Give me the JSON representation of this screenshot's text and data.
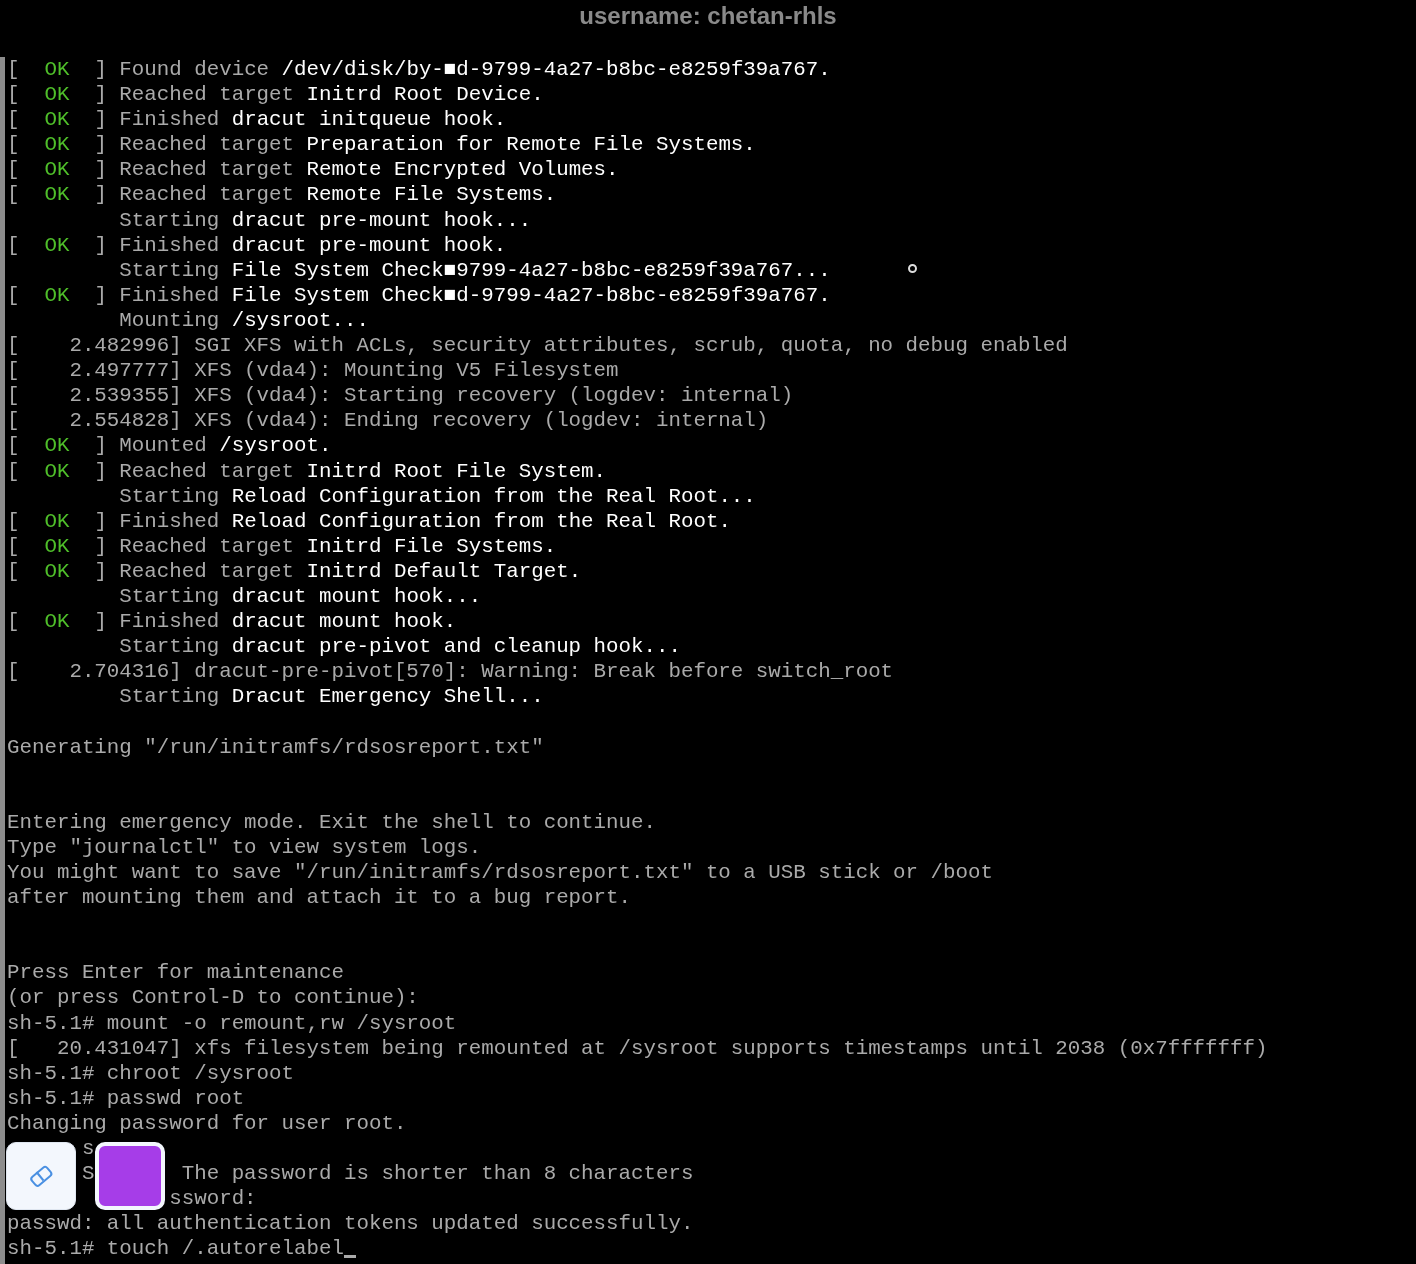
{
  "window": {
    "title": "username: chetan-rhls"
  },
  "lines": [
    {
      "kind": "text",
      "parts": [
        {
          "kind": "dim",
          "text": "[  "
        },
        {
          "kind": "ok",
          "text": "OK"
        },
        {
          "kind": "dim",
          "text": "  ] Found device "
        },
        {
          "kind": "bright",
          "text": "/dev/disk/by-■d-9799-4a27-b8bc-e8259f39a767."
        }
      ]
    },
    {
      "kind": "text",
      "parts": [
        {
          "kind": "dim",
          "text": "[  "
        },
        {
          "kind": "ok",
          "text": "OK"
        },
        {
          "kind": "dim",
          "text": "  ] Reached target "
        },
        {
          "kind": "bright",
          "text": "Initrd Root Device."
        }
      ]
    },
    {
      "kind": "text",
      "parts": [
        {
          "kind": "dim",
          "text": "[  "
        },
        {
          "kind": "ok",
          "text": "OK"
        },
        {
          "kind": "dim",
          "text": "  ] Finished "
        },
        {
          "kind": "bright",
          "text": "dracut initqueue hook."
        }
      ]
    },
    {
      "kind": "text",
      "parts": [
        {
          "kind": "dim",
          "text": "[  "
        },
        {
          "kind": "ok",
          "text": "OK"
        },
        {
          "kind": "dim",
          "text": "  ] Reached target "
        },
        {
          "kind": "bright",
          "text": "Preparation for Remote File Systems."
        }
      ]
    },
    {
      "kind": "text",
      "parts": [
        {
          "kind": "dim",
          "text": "[  "
        },
        {
          "kind": "ok",
          "text": "OK"
        },
        {
          "kind": "dim",
          "text": "  ] Reached target "
        },
        {
          "kind": "bright",
          "text": "Remote Encrypted Volumes."
        }
      ]
    },
    {
      "kind": "text",
      "parts": [
        {
          "kind": "dim",
          "text": "[  "
        },
        {
          "kind": "ok",
          "text": "OK"
        },
        {
          "kind": "dim",
          "text": "  ] Reached target "
        },
        {
          "kind": "bright",
          "text": "Remote File Systems."
        }
      ]
    },
    {
      "kind": "text",
      "parts": [
        {
          "kind": "dim",
          "text": "         Starting "
        },
        {
          "kind": "bright",
          "text": "dracut pre-mount hook..."
        }
      ]
    },
    {
      "kind": "text",
      "parts": [
        {
          "kind": "dim",
          "text": "[  "
        },
        {
          "kind": "ok",
          "text": "OK"
        },
        {
          "kind": "dim",
          "text": "  ] Finished "
        },
        {
          "kind": "bright",
          "text": "dracut pre-mount hook."
        }
      ]
    },
    {
      "kind": "text",
      "parts": [
        {
          "kind": "dim",
          "text": "         Starting "
        },
        {
          "kind": "bright",
          "text": "File System Check■9799-4a27-b8bc-e8259f39a767..."
        }
      ]
    },
    {
      "kind": "text",
      "parts": [
        {
          "kind": "dim",
          "text": "[  "
        },
        {
          "kind": "ok",
          "text": "OK"
        },
        {
          "kind": "dim",
          "text": "  ] Finished "
        },
        {
          "kind": "bright",
          "text": "File System Check■d-9799-4a27-b8bc-e8259f39a767."
        }
      ]
    },
    {
      "kind": "text",
      "parts": [
        {
          "kind": "dim",
          "text": "         Mounting "
        },
        {
          "kind": "bright",
          "text": "/sysroot..."
        }
      ]
    },
    {
      "kind": "text",
      "parts": [
        {
          "kind": "dim",
          "text": "[    2.482996] SGI XFS with ACLs, security attributes, scrub, quota, no debug enabled"
        }
      ]
    },
    {
      "kind": "text",
      "parts": [
        {
          "kind": "dim",
          "text": "[    2.497777] XFS (vda4): Mounting V5 Filesystem"
        }
      ]
    },
    {
      "kind": "text",
      "parts": [
        {
          "kind": "dim",
          "text": "[    2.539355] XFS (vda4): Starting recovery (logdev: internal)"
        }
      ]
    },
    {
      "kind": "text",
      "parts": [
        {
          "kind": "dim",
          "text": "[    2.554828] XFS (vda4): Ending recovery (logdev: internal)"
        }
      ]
    },
    {
      "kind": "text",
      "parts": [
        {
          "kind": "dim",
          "text": "[  "
        },
        {
          "kind": "ok",
          "text": "OK"
        },
        {
          "kind": "dim",
          "text": "  ] Mounted "
        },
        {
          "kind": "bright",
          "text": "/sysroot."
        }
      ]
    },
    {
      "kind": "text",
      "parts": [
        {
          "kind": "dim",
          "text": "[  "
        },
        {
          "kind": "ok",
          "text": "OK"
        },
        {
          "kind": "dim",
          "text": "  ] Reached target "
        },
        {
          "kind": "bright",
          "text": "Initrd Root File System."
        }
      ]
    },
    {
      "kind": "text",
      "parts": [
        {
          "kind": "dim",
          "text": "         Starting "
        },
        {
          "kind": "bright",
          "text": "Reload Configuration from the Real Root..."
        }
      ]
    },
    {
      "kind": "text",
      "parts": [
        {
          "kind": "dim",
          "text": "[  "
        },
        {
          "kind": "ok",
          "text": "OK"
        },
        {
          "kind": "dim",
          "text": "  ] Finished "
        },
        {
          "kind": "bright",
          "text": "Reload Configuration from the Real Root."
        }
      ]
    },
    {
      "kind": "text",
      "parts": [
        {
          "kind": "dim",
          "text": "[  "
        },
        {
          "kind": "ok",
          "text": "OK"
        },
        {
          "kind": "dim",
          "text": "  ] Reached target "
        },
        {
          "kind": "bright",
          "text": "Initrd File Systems."
        }
      ]
    },
    {
      "kind": "text",
      "parts": [
        {
          "kind": "dim",
          "text": "[  "
        },
        {
          "kind": "ok",
          "text": "OK"
        },
        {
          "kind": "dim",
          "text": "  ] Reached target "
        },
        {
          "kind": "bright",
          "text": "Initrd Default Target."
        }
      ]
    },
    {
      "kind": "text",
      "parts": [
        {
          "kind": "dim",
          "text": "         Starting "
        },
        {
          "kind": "bright",
          "text": "dracut mount hook..."
        }
      ]
    },
    {
      "kind": "text",
      "parts": [
        {
          "kind": "dim",
          "text": "[  "
        },
        {
          "kind": "ok",
          "text": "OK"
        },
        {
          "kind": "dim",
          "text": "  ] Finished "
        },
        {
          "kind": "bright",
          "text": "dracut mount hook."
        }
      ]
    },
    {
      "kind": "text",
      "parts": [
        {
          "kind": "dim",
          "text": "         Starting "
        },
        {
          "kind": "bright",
          "text": "dracut pre-pivot and cleanup hook..."
        }
      ]
    },
    {
      "kind": "text",
      "parts": [
        {
          "kind": "dim",
          "text": "[    2.704316] dracut-pre-pivot[570]: Warning: Break before switch_root"
        }
      ]
    },
    {
      "kind": "text",
      "parts": [
        {
          "kind": "dim",
          "text": "         Starting "
        },
        {
          "kind": "bright",
          "text": "Dracut Emergency Shell..."
        }
      ]
    },
    {
      "kind": "blank"
    },
    {
      "kind": "text",
      "parts": [
        {
          "kind": "dim",
          "text": "Generating \"/run/initramfs/rdsosreport.txt\""
        }
      ]
    },
    {
      "kind": "blank"
    },
    {
      "kind": "blank"
    },
    {
      "kind": "text",
      "parts": [
        {
          "kind": "dim",
          "text": "Entering emergency mode. Exit the shell to continue."
        }
      ]
    },
    {
      "kind": "text",
      "parts": [
        {
          "kind": "dim",
          "text": "Type \"journalctl\" to view system logs."
        }
      ]
    },
    {
      "kind": "text",
      "parts": [
        {
          "kind": "dim",
          "text": "You might want to save \"/run/initramfs/rdsosreport.txt\" to a USB stick or /boot"
        }
      ]
    },
    {
      "kind": "text",
      "parts": [
        {
          "kind": "dim",
          "text": "after mounting them and attach it to a bug report."
        }
      ]
    },
    {
      "kind": "blank"
    },
    {
      "kind": "blank"
    },
    {
      "kind": "text",
      "parts": [
        {
          "kind": "dim",
          "text": "Press Enter for maintenance"
        }
      ]
    },
    {
      "kind": "text",
      "parts": [
        {
          "kind": "dim",
          "text": "(or press Control-D to continue):"
        }
      ]
    },
    {
      "kind": "text",
      "parts": [
        {
          "kind": "dim",
          "text": "sh-5.1# mount -o remount,rw /sysroot"
        }
      ]
    },
    {
      "kind": "text",
      "parts": [
        {
          "kind": "dim",
          "text": "[   20.431047] xfs filesystem being remounted at /sysroot supports timestamps until 2038 (0x7fffffff)"
        }
      ]
    },
    {
      "kind": "text",
      "parts": [
        {
          "kind": "dim",
          "text": "sh-5.1# chroot /sysroot"
        }
      ]
    },
    {
      "kind": "text",
      "parts": [
        {
          "kind": "dim",
          "text": "sh-5.1# passwd root"
        }
      ]
    },
    {
      "kind": "text",
      "parts": [
        {
          "kind": "dim",
          "text": "Changing password for user root."
        }
      ]
    },
    {
      "kind": "split",
      "parts": [
        {
          "kind": "dim",
          "text": "      s"
        }
      ]
    },
    {
      "kind": "split",
      "parts": [
        {
          "kind": "dim",
          "text": "      S"
        },
        {
          "kind": "dim",
          "text": "       The password is shorter than 8 characters"
        }
      ]
    },
    {
      "kind": "split",
      "parts": [
        {
          "kind": "dim",
          "text": "             ssword:"
        }
      ]
    },
    {
      "kind": "text",
      "parts": [
        {
          "kind": "dim",
          "text": "passwd: all authentication tokens updated successfully."
        }
      ]
    },
    {
      "kind": "text",
      "cursor": true,
      "parts": [
        {
          "kind": "dim",
          "text": "sh-5.1# touch /.autorelabel"
        }
      ]
    }
  ],
  "toolbar": [
    {
      "kind": "eraser"
    },
    {
      "kind": "swatch",
      "color": "#a63de8"
    }
  ]
}
